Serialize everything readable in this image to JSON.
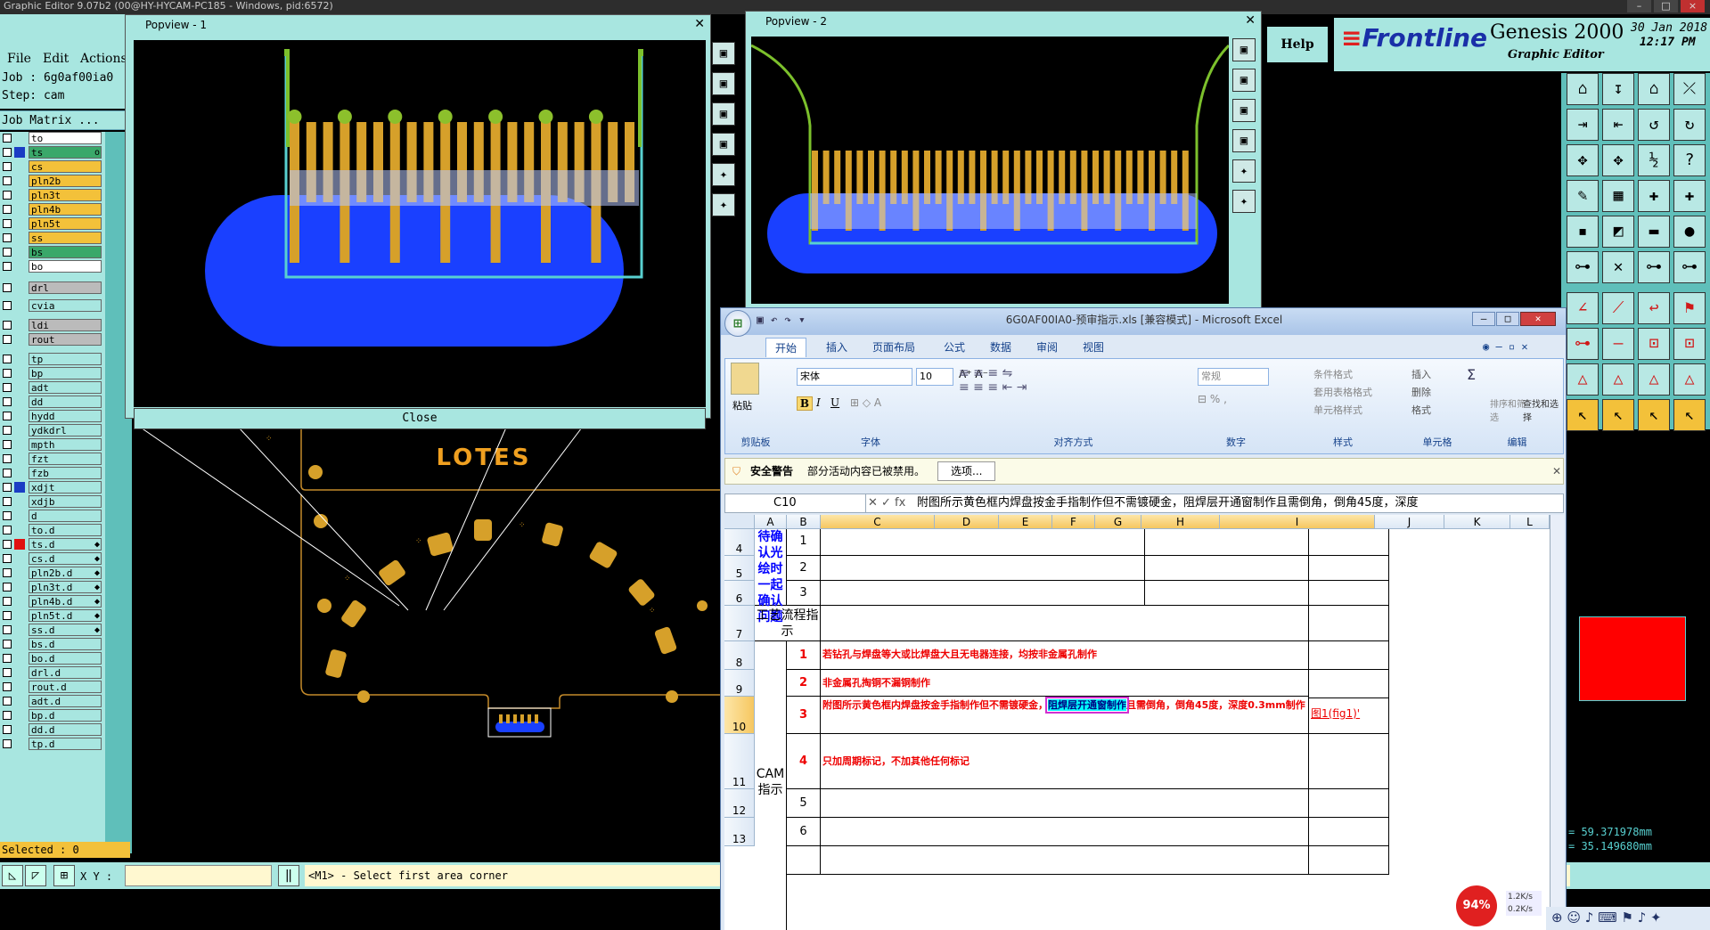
{
  "app": {
    "title": "Graphic Editor 9.07b2 (00@HY-HYCAM-PC185 - Windows, pid:6572)",
    "menu": [
      "File",
      "Edit",
      "Actions"
    ],
    "job_line": "Job : 6g0af00ia0",
    "step_line": "Step: cam",
    "job_matrix": "Job Matrix ...",
    "help": "Help",
    "brand": "Frontline",
    "product": "Genesis 2000",
    "subproduct": "Graphic Editor",
    "date": "30 Jan 2018",
    "time": "12:17 PM",
    "selected": "Selected : 0",
    "xy_label": "X Y :",
    "status_message": "<M1> - Select first area corner",
    "coord_x": "= 59.371978mm",
    "coord_y": "= 35.149680mm",
    "units": "MM",
    "board_label": "LOTES"
  },
  "layers": [
    {
      "name": "to",
      "color": "#ffffff",
      "mark": ""
    },
    {
      "name": "ts",
      "color": "#3aa86a",
      "mark": "o",
      "sel": "#1a3cc4"
    },
    {
      "name": "cs",
      "color": "#f3c13a",
      "mark": ""
    },
    {
      "name": "pln2b",
      "color": "#f3c13a",
      "mark": ""
    },
    {
      "name": "pln3t",
      "color": "#f3c13a",
      "mark": ""
    },
    {
      "name": "pln4b",
      "color": "#f3c13a",
      "mark": ""
    },
    {
      "name": "pln5t",
      "color": "#f3c13a",
      "mark": ""
    },
    {
      "name": "ss",
      "color": "#f3c13a",
      "mark": ""
    },
    {
      "name": "bs",
      "color": "#3aa86a",
      "mark": ""
    },
    {
      "name": "bo",
      "color": "#ffffff",
      "mark": ""
    },
    {
      "name": "drl",
      "color": "#bbbbbb",
      "mark": ""
    },
    {
      "name": "cvia",
      "color": "#a8e6e0",
      "mark": ""
    },
    {
      "name": "ldi",
      "color": "#bbbbbb",
      "mark": ""
    },
    {
      "name": "rout",
      "color": "#bbbbbb",
      "mark": ""
    },
    {
      "name": "tp",
      "color": "#a8e6e0",
      "mark": ""
    },
    {
      "name": "bp",
      "color": "#a8e6e0",
      "mark": ""
    },
    {
      "name": "adt",
      "color": "#a8e6e0",
      "mark": ""
    },
    {
      "name": "dd",
      "color": "#a8e6e0",
      "mark": ""
    },
    {
      "name": "hydd",
      "color": "#a8e6e0",
      "mark": ""
    },
    {
      "name": "ydkdrl",
      "color": "#a8e6e0",
      "mark": ""
    },
    {
      "name": "mpth",
      "color": "#a8e6e0",
      "mark": ""
    },
    {
      "name": "fzt",
      "color": "#a8e6e0",
      "mark": ""
    },
    {
      "name": "fzb",
      "color": "#a8e6e0",
      "mark": ""
    },
    {
      "name": "xdjt",
      "color": "#a8e6e0",
      "mark": "",
      "sel": "#1a3cc4"
    },
    {
      "name": "xdjb",
      "color": "#a8e6e0",
      "mark": ""
    },
    {
      "name": "d",
      "color": "#a8e6e0",
      "mark": ""
    },
    {
      "name": "to.d",
      "color": "#a8e6e0",
      "mark": ""
    },
    {
      "name": "ts.d",
      "color": "#a8e6e0",
      "mark": "◆",
      "sel": "#e01010"
    },
    {
      "name": "cs.d",
      "color": "#a8e6e0",
      "mark": "◆"
    },
    {
      "name": "pln2b.d",
      "color": "#a8e6e0",
      "mark": "◆"
    },
    {
      "name": "pln3t.d",
      "color": "#a8e6e0",
      "mark": "◆"
    },
    {
      "name": "pln4b.d",
      "color": "#a8e6e0",
      "mark": "◆"
    },
    {
      "name": "pln5t.d",
      "color": "#a8e6e0",
      "mark": "◆"
    },
    {
      "name": "ss.d",
      "color": "#a8e6e0",
      "mark": "◆"
    },
    {
      "name": "bs.d",
      "color": "#a8e6e0",
      "mark": ""
    },
    {
      "name": "bo.d",
      "color": "#a8e6e0",
      "mark": ""
    },
    {
      "name": "drl.d",
      "color": "#a8e6e0",
      "mark": ""
    },
    {
      "name": "rout.d",
      "color": "#a8e6e0",
      "mark": ""
    },
    {
      "name": "adt.d",
      "color": "#a8e6e0",
      "mark": ""
    },
    {
      "name": "bp.d",
      "color": "#a8e6e0",
      "mark": ""
    },
    {
      "name": "dd.d",
      "color": "#a8e6e0",
      "mark": ""
    },
    {
      "name": "tp.d",
      "color": "#a8e6e0",
      "mark": ""
    }
  ],
  "popview1": {
    "title": "Popview - 1",
    "close": "Close"
  },
  "popview2": {
    "title": "Popview - 2"
  },
  "excel": {
    "title": "6G0AF00IA0-预审指示.xls [兼容模式] - Microsoft Excel",
    "tabs": [
      "开始",
      "插入",
      "页面布局",
      "公式",
      "数据",
      "审阅",
      "视图"
    ],
    "font_name": "宋体",
    "font_size": "10",
    "number_format": "常规",
    "groups": [
      "剪贴板",
      "字体",
      "对齐方式",
      "数字",
      "样式",
      "单元格",
      "编辑"
    ],
    "paste": "粘贴",
    "style_items": [
      "条件格式",
      "套用表格格式",
      "单元格样式"
    ],
    "cell_items": [
      "插入",
      "删除",
      "格式"
    ],
    "edit_items": [
      "排序和筛选",
      "查找和选择"
    ],
    "security_title": "安全警告",
    "security_text": "部分活动内容已被禁用。",
    "options_button": "选项...",
    "name_box": "C10",
    "formula": "附图所示黄色框内焊盘按金手指制作但不需镀硬金，阻焊层开通窗制作且需倒角，倒角45度，深度",
    "columns": [
      "A",
      "B",
      "C",
      "D",
      "E",
      "F",
      "G",
      "H",
      "I",
      "J",
      "K",
      "L"
    ],
    "row_numbers": [
      "4",
      "5",
      "6",
      "7",
      "8",
      "9",
      "10",
      "11",
      "12",
      "13"
    ],
    "confirm_label": "待确认光绘时一起确认问题",
    "process_label": "工艺流程指示",
    "cam_label": "CAM指示",
    "items": [
      "1",
      "2",
      "3",
      "1",
      "2",
      "3",
      "4",
      "5",
      "6"
    ],
    "instr1": "若钻孔与焊盘等大或比焊盘大且无电器连接，均按非金属孔制作",
    "instr2": "非金属孔掏铜不漏铜制作",
    "instr3_a": "附图所示黄色框内焊盘按金手指制作但不需镀硬金，",
    "instr3_hl": "阻焊层开通窗制作",
    "instr3_b": "且需倒角，倒角45度，深度0.3mm制作",
    "instr3_ref": "图1(fig1)'",
    "instr4": "只加周期标记，不加其他任何标记"
  },
  "tray": {
    "percent": "94%",
    "up": "1.2K/s",
    "down": "0.2K/s"
  }
}
